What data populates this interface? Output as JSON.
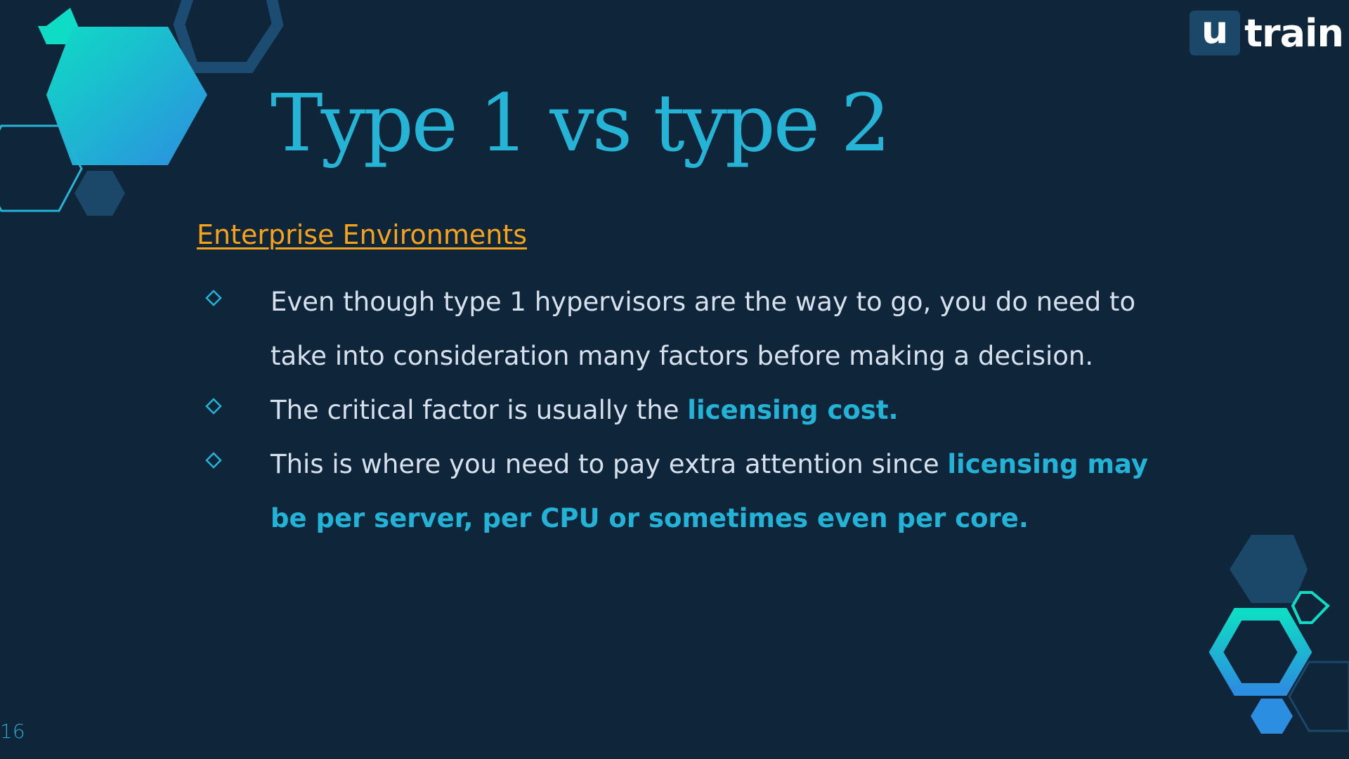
{
  "logo": {
    "box_letter": "u",
    "text": "train"
  },
  "slide": {
    "title": "Type 1 vs type 2",
    "subtitle": "Enterprise Environments",
    "page_number": "16"
  },
  "bullets": [
    {
      "text": "Even though type 1 hypervisors are the way to go, you do need to take into consideration many factors before making a decision.",
      "highlight": ""
    },
    {
      "text": "The critical factor is usually the ",
      "highlight": "licensing cost."
    },
    {
      "text": "This is where you need to pay extra attention since ",
      "highlight": "licensing may be per server, per CPU or sometimes even per core."
    }
  ],
  "icons": {
    "bullet": "diamond-outline-icon",
    "decoration": "hexagon-icon"
  },
  "colors": {
    "background": "#0f253a",
    "title": "#26b4d6",
    "subtitle": "#f4a31a",
    "body_text": "#d7e1ee",
    "highlight": "#23b3d6",
    "hex_dark": "#1b4769",
    "hex_teal": "#0fdcc4",
    "hex_blue": "#2c8ee0"
  }
}
